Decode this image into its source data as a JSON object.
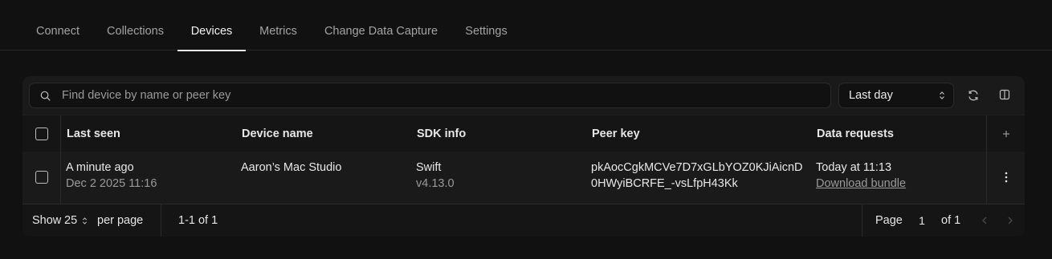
{
  "tabs": [
    {
      "label": "Connect",
      "active": false
    },
    {
      "label": "Collections",
      "active": false
    },
    {
      "label": "Devices",
      "active": true
    },
    {
      "label": "Metrics",
      "active": false
    },
    {
      "label": "Change Data Capture",
      "active": false
    },
    {
      "label": "Settings",
      "active": false
    }
  ],
  "toolbar": {
    "search_placeholder": "Find device by name or peer key",
    "range_value": "Last day",
    "icons": [
      "search-icon",
      "refresh-icon",
      "columns-icon"
    ]
  },
  "table": {
    "columns": [
      "Last seen",
      "Device name",
      "SDK info",
      "Peer key",
      "Data requests"
    ],
    "add_column_icon": "plus-icon",
    "rows": [
      {
        "last_seen": "A minute ago",
        "last_seen_date": "Dec 2 2025 11:16",
        "device_name": "Aaron’s Mac Studio",
        "sdk": "Swift",
        "sdk_version": "v4.13.0",
        "peer_key_line1": "pkAocCgkMCVe7D7xGLbYOZ0KJiAicnD",
        "peer_key_line2": "0HWyiBCRFE_-vsLfpH43Kk",
        "data_request": "Today at 11:13",
        "data_request_link": "Download bundle",
        "menu_icon": "more-vertical-icon"
      }
    ]
  },
  "footer": {
    "show_label": "Show",
    "page_size": "25",
    "per_page_label": "per page",
    "range_text": "1-1 of 1",
    "page_label": "Page",
    "page_number": "1",
    "of_pages": "of 1"
  },
  "colors": {
    "background": "#111111",
    "panel": "#1a1a1a",
    "active_tab_underline": "#e8e8e8",
    "muted_text": "#9a9a9a"
  }
}
